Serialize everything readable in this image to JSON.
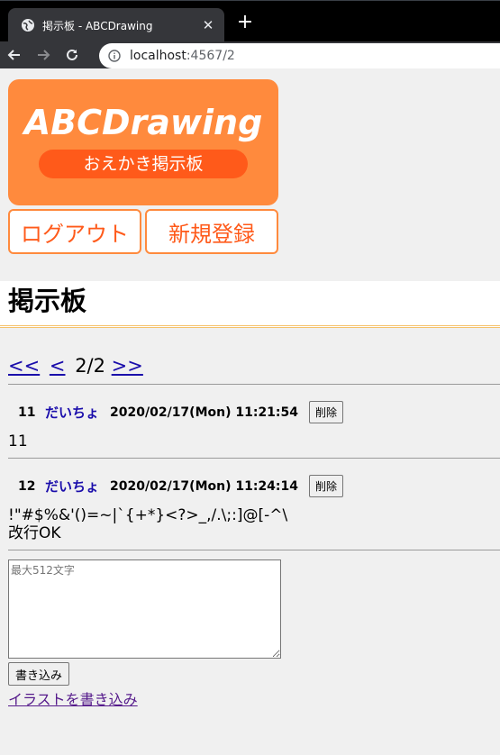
{
  "browser": {
    "tab_title": "掲示板 - ABCDrawing",
    "close_glyph": "✕",
    "new_tab_glyph": "+",
    "url_host": "localhost",
    "url_path": ":4567/2"
  },
  "logo": {
    "title": "ABCDrawing",
    "subtitle": "おえかき掲示板"
  },
  "nav": {
    "logout_label": "ログアウト",
    "register_label": "新規登録"
  },
  "heading": "掲示板",
  "pager": {
    "first": "<<",
    "prev": "<",
    "current": "2/2",
    "last": ">>"
  },
  "posts": [
    {
      "no": "11",
      "name": "だいちょ",
      "date": "2020/02/17(Mon) 11:21:54",
      "delete_label": "削除",
      "body": "11"
    },
    {
      "no": "12",
      "name": "だいちょ",
      "date": "2020/02/17(Mon) 11:24:14",
      "delete_label": "削除",
      "body": "!\"#$%&'()=~|`{+*}<?>_,/.\\;:]@[-^\\\n改行OK"
    }
  ],
  "form": {
    "placeholder": "最大512文字",
    "submit_label": "書き込み",
    "illust_link": "イラストを書き込み"
  },
  "colors": {
    "brand_orange": "#ff8a3d",
    "brand_red_orange": "#ff5a1a",
    "link": "#1a0dab"
  }
}
